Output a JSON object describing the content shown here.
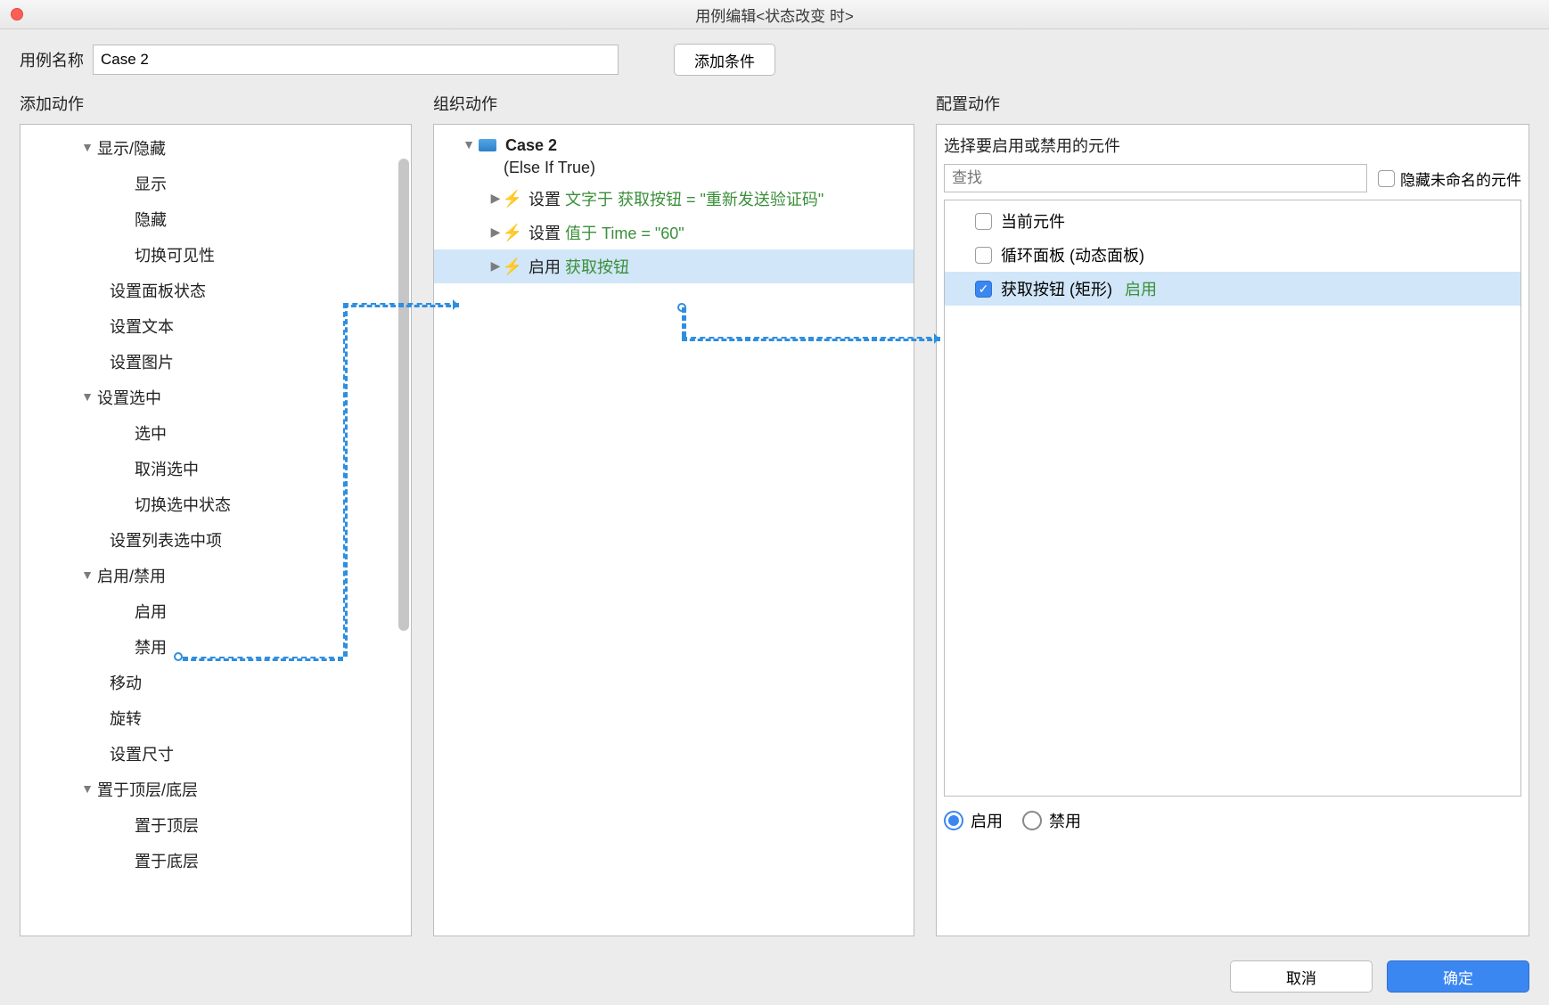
{
  "title": "用例编辑<状态改变 时>",
  "top": {
    "name_label": "用例名称",
    "case_value": "Case 2",
    "add_condition": "添加条件"
  },
  "cols": {
    "add_action": "添加动作",
    "organize_action": "组织动作",
    "config_action": "配置动作"
  },
  "actions_tree": [
    {
      "type": "group",
      "label": "显示/隐藏",
      "children": [
        "显示",
        "隐藏",
        "切换可见性"
      ]
    },
    {
      "type": "item",
      "label": "设置面板状态"
    },
    {
      "type": "item",
      "label": "设置文本"
    },
    {
      "type": "item",
      "label": "设置图片"
    },
    {
      "type": "group",
      "label": "设置选中",
      "children": [
        "选中",
        "取消选中",
        "切换选中状态"
      ]
    },
    {
      "type": "item",
      "label": "设置列表选中项"
    },
    {
      "type": "group",
      "label": "启用/禁用",
      "children": [
        "启用",
        "禁用"
      ]
    },
    {
      "type": "item",
      "label": "移动"
    },
    {
      "type": "item",
      "label": "旋转"
    },
    {
      "type": "item",
      "label": "设置尺寸"
    },
    {
      "type": "group",
      "label": "置于顶层/底层",
      "children": [
        "置于顶层",
        "置于底层"
      ]
    }
  ],
  "organize": {
    "case_name": "Case 2",
    "else_if": "(Else If True)",
    "steps": [
      {
        "k": "设置",
        "g": "文字于 获取按钮 = \"重新发送验证码\""
      },
      {
        "k": "设置",
        "g": "值于 Time = \"60\""
      },
      {
        "k": "启用",
        "g": "获取按钮",
        "selected": true
      }
    ]
  },
  "config": {
    "prompt": "选择要启用或禁用的元件",
    "search_placeholder": "查找",
    "hide_unnamed": "隐藏未命名的元件",
    "items": [
      {
        "label": "当前元件",
        "checked": false
      },
      {
        "label": "循环面板 (动态面板)",
        "checked": false
      },
      {
        "label": "获取按钮 (矩形)",
        "checked": true,
        "suffix": "启用",
        "selected": true
      }
    ],
    "enable_label": "启用",
    "disable_label": "禁用"
  },
  "footer": {
    "cancel": "取消",
    "ok": "确定"
  }
}
